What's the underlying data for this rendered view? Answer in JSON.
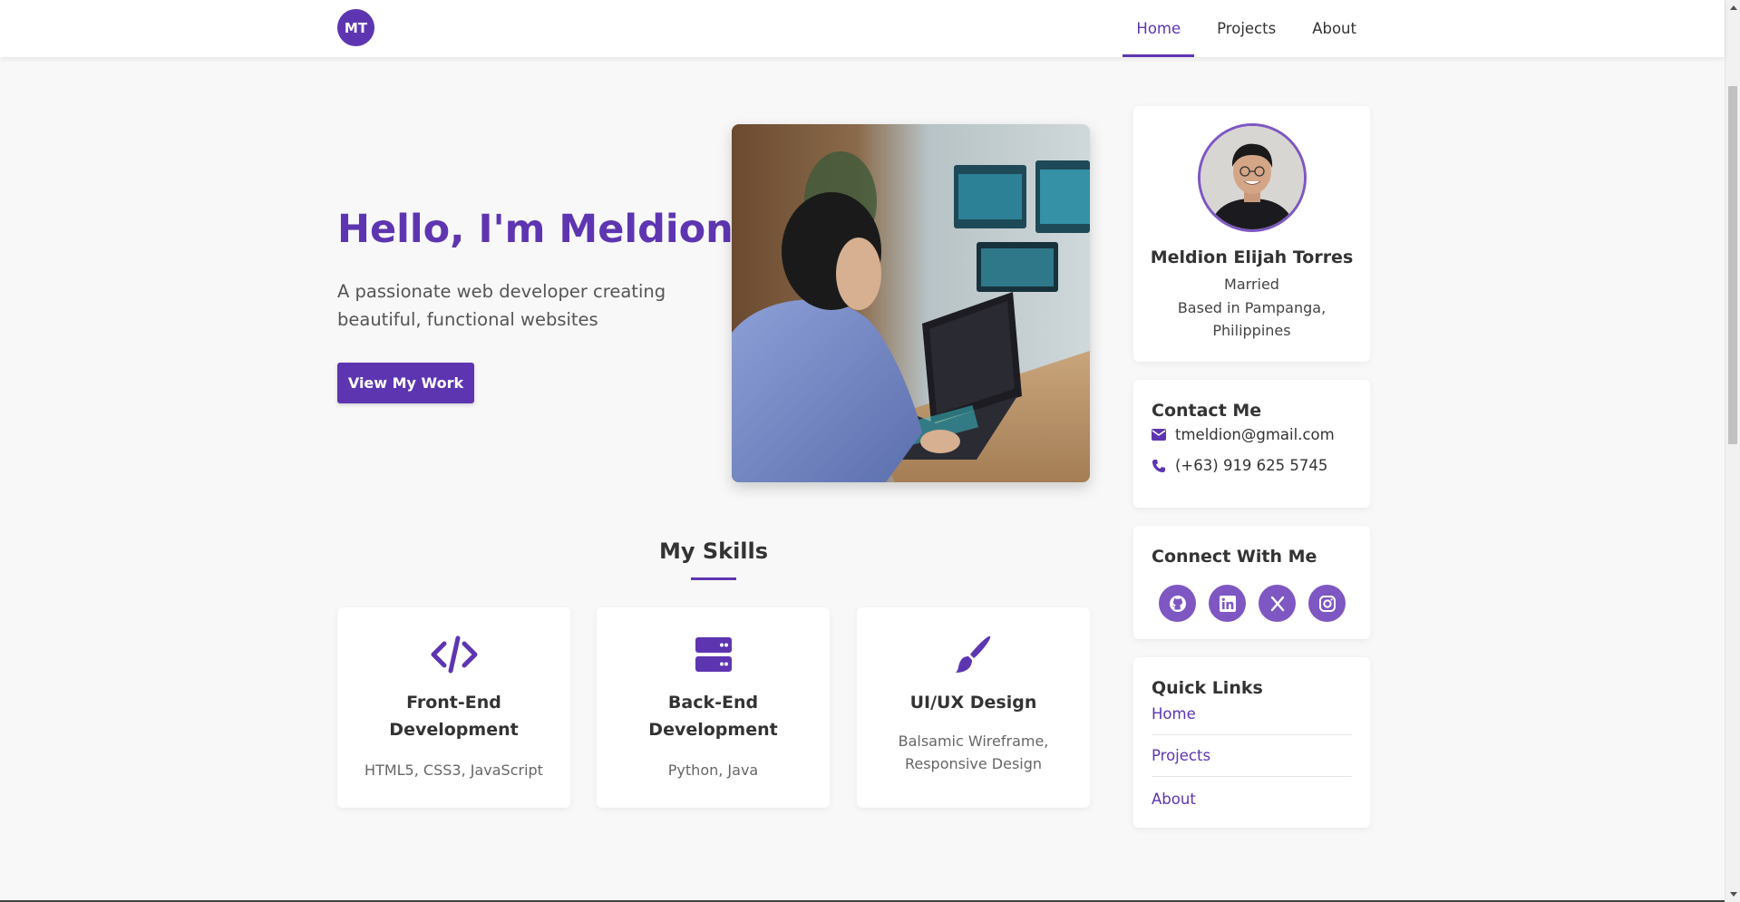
{
  "nav": {
    "logo": "MT",
    "links": [
      {
        "label": "Home",
        "active": true
      },
      {
        "label": "Projects",
        "active": false
      },
      {
        "label": "About",
        "active": false
      }
    ]
  },
  "hero": {
    "title": "Hello, I'm Meldion",
    "subtitle": "A passionate web developer creating beautiful, functional websites",
    "button": "View My Work",
    "image": "photo-person-at-laptop"
  },
  "skills": {
    "title": "My Skills",
    "cards": [
      {
        "icon": "code-icon",
        "name": "Front-End Development",
        "desc": "HTML5, CSS3, JavaScript"
      },
      {
        "icon": "server-icon",
        "name": "Back-End Development",
        "desc": "Python, Java"
      },
      {
        "icon": "paintbrush-icon",
        "name": "UI/UX Design",
        "desc": "Balsamic Wireframe, Responsive Design"
      }
    ]
  },
  "profile": {
    "name": "Meldion Elijah Torres",
    "status": "Married",
    "location": "Based in Pampanga, Philippines"
  },
  "contact": {
    "title": "Contact Me",
    "email": "tmeldion@gmail.com",
    "phone": "(+63) 919 625 5745"
  },
  "connect": {
    "title": "Connect With Me",
    "icons": [
      "github-icon",
      "linkedin-icon",
      "x-icon",
      "instagram-icon"
    ]
  },
  "quick_links": {
    "title": "Quick Links",
    "items": [
      "Home",
      "Projects",
      "About"
    ]
  },
  "colors": {
    "accent": "#5e35b1",
    "accent_light": "#7e57c2",
    "background": "#f8f8f8"
  }
}
